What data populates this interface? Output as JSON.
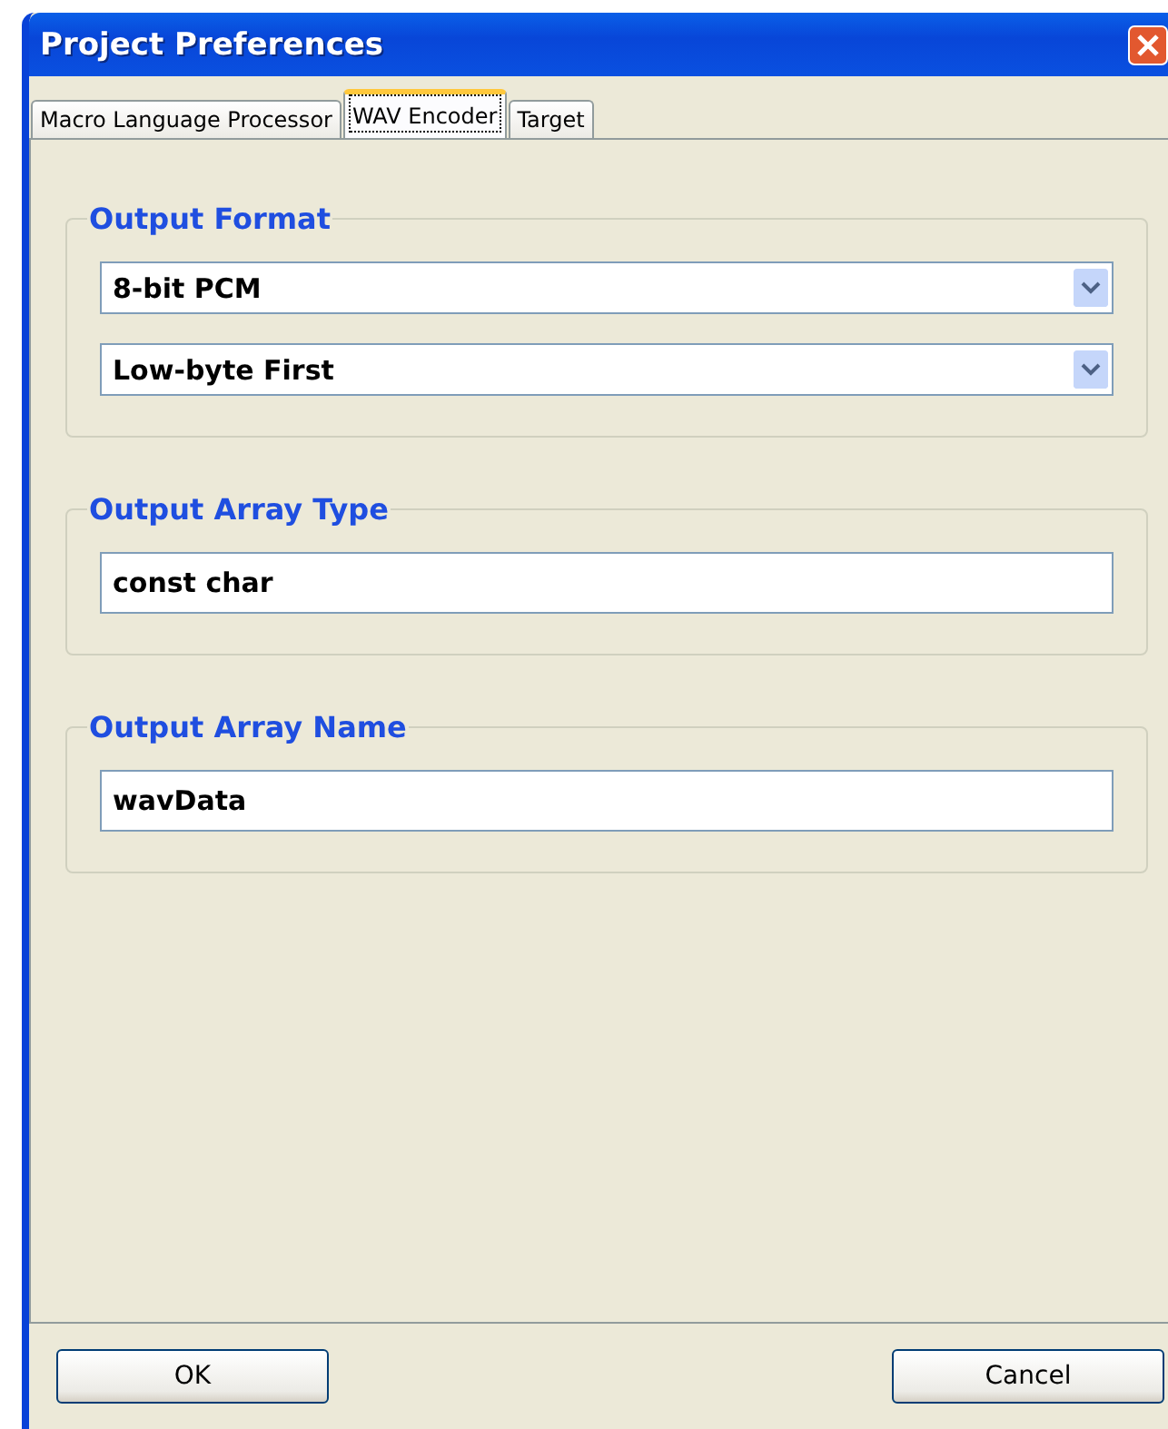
{
  "window": {
    "title": "Project Preferences"
  },
  "tabs": [
    {
      "label": "Macro Language Processor",
      "selected": false
    },
    {
      "label": "WAV Encoder",
      "selected": true
    },
    {
      "label": "Target",
      "selected": false
    }
  ],
  "groups": [
    {
      "title": "Output Format",
      "fields": [
        {
          "kind": "dropdown",
          "value": "8-bit PCM"
        },
        {
          "kind": "dropdown",
          "value": "Low-byte First"
        }
      ]
    },
    {
      "title": "Output Array Type",
      "fields": [
        {
          "kind": "text",
          "value": "const char"
        }
      ]
    },
    {
      "title": "Output Array Name",
      "fields": [
        {
          "kind": "text",
          "value": "wavData"
        }
      ]
    }
  ],
  "buttons": [
    "OK",
    "Cancel"
  ]
}
